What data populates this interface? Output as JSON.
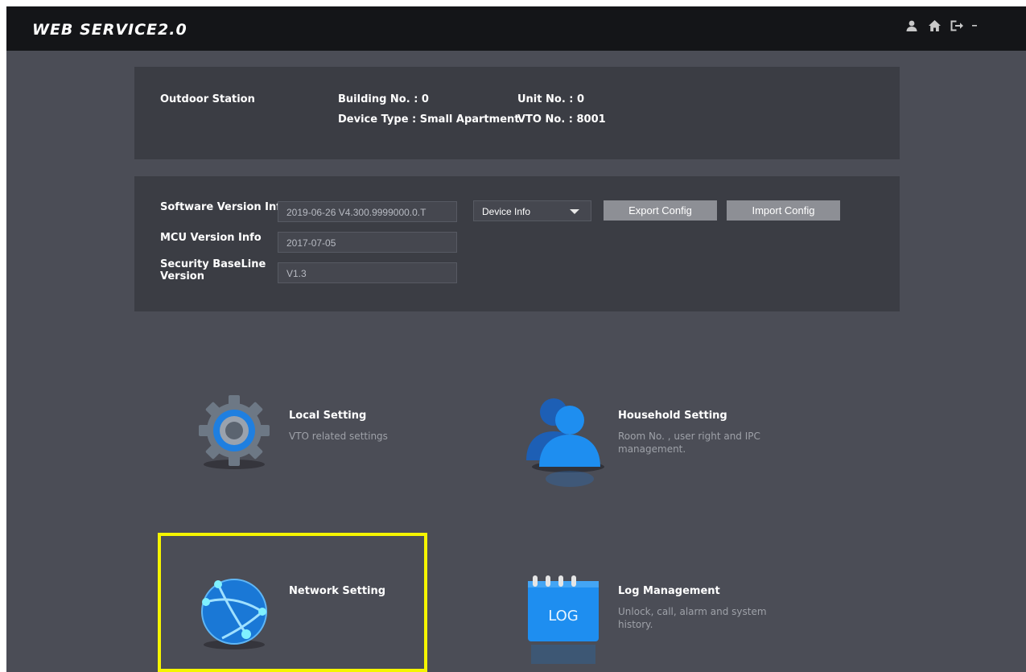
{
  "header": {
    "brand": "WEB SERVICE2.0",
    "icons": [
      "user-icon",
      "home-icon",
      "logout-icon",
      "chevron-down-icon"
    ]
  },
  "device": {
    "station": "Outdoor Station",
    "building": "Building No. : 0",
    "unit": "Unit No. : 0",
    "type": "Device Type : Small Apartment",
    "vto": "VTO No. : 8001"
  },
  "versions": {
    "software_label": "Software Version Info",
    "software_value": "2019-06-26 V4.300.9999000.0.T",
    "mcu_label": "MCU Version Info",
    "mcu_value": "2017-07-05",
    "security_label_line1": "Security BaseLine",
    "security_label_line2": "Version",
    "security_value": "V1.3",
    "dropdown_value": "Device Info",
    "export_label": "Export Config",
    "import_label": "Import Config"
  },
  "tiles": [
    {
      "title": "Local Setting",
      "desc": "VTO related settings",
      "icon": "gear-icon"
    },
    {
      "title": "Household Setting",
      "desc": "Room No. , user right and IPC management.",
      "icon": "users-icon"
    },
    {
      "title": "Network Setting",
      "desc": "",
      "icon": "globe-icon"
    },
    {
      "title": "Log Management",
      "desc": "Unlock, call, alarm and system history.",
      "icon": "log-icon",
      "icon_text": "LOG"
    }
  ],
  "colors": {
    "background": "#4b4d56",
    "panel": "#3b3d44",
    "topbar": "#141518",
    "highlight": "#f5f500",
    "accent": "#1e90e6"
  }
}
